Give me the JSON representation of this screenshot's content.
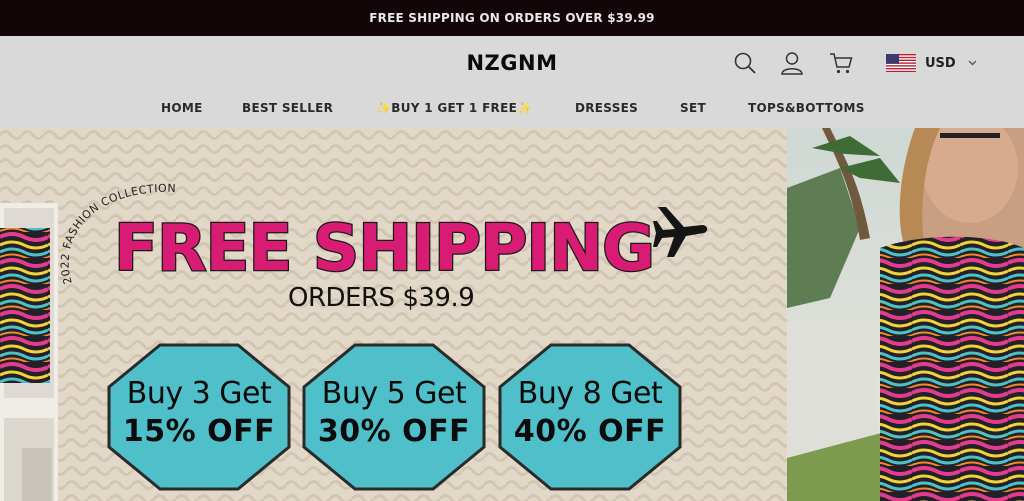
{
  "announcement": "FREE SHIPPING ON ORDERS OVER $39.99",
  "header": {
    "logo": "NZGNM",
    "icons": [
      "search-icon",
      "user-icon",
      "cart-icon"
    ],
    "currency": "USD"
  },
  "nav": {
    "items": [
      {
        "label": "HOME"
      },
      {
        "label": "BEST SELLER"
      },
      {
        "label": "✨BUY 1 GET 1 FREE✨"
      },
      {
        "label": "DRESSES"
      },
      {
        "label": "SET"
      },
      {
        "label": "TOPS&BOTTOMS"
      }
    ]
  },
  "hero": {
    "collection_text": "2022 FASHION COLLECTION",
    "headline": "FREE SHIPPING",
    "subline": "ORDERS $39.9",
    "offers": [
      {
        "line1": "Buy 3 Get",
        "line2": "15% OFF"
      },
      {
        "line1": "Buy 5 Get",
        "line2": "30% OFF"
      },
      {
        "line1": "Buy 8 Get",
        "line2": "40% OFF"
      }
    ],
    "colors": {
      "headline_pink": "#d81b73",
      "badge_teal": "#4fbfc9",
      "announcement_bg": "#120608"
    }
  }
}
